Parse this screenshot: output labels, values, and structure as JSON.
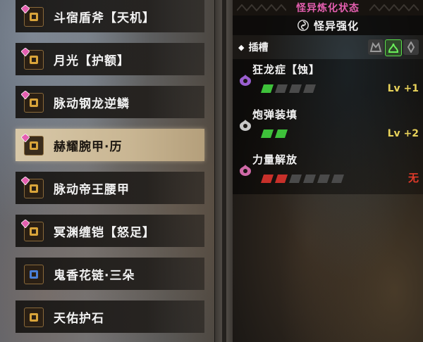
{
  "equipment_list": {
    "items": [
      {
        "name": "斗宿盾斧【天机】",
        "selected": false,
        "has_gem": true
      },
      {
        "name": "月光【护额】",
        "selected": false,
        "has_gem": true
      },
      {
        "name": "脉动钢龙逆鳞",
        "selected": false,
        "has_gem": true
      },
      {
        "name": "赫耀腕甲·历",
        "selected": true,
        "has_gem": true
      },
      {
        "name": "脉动帝王腰甲",
        "selected": false,
        "has_gem": true
      },
      {
        "name": "冥渊缠铠【怒足】",
        "selected": false,
        "has_gem": true
      },
      {
        "name": "鬼香花链·三朵",
        "selected": false,
        "has_gem": false
      },
      {
        "name": "天佑护石",
        "selected": false,
        "has_gem": false
      }
    ]
  },
  "panel": {
    "title": "怪异炼化状态",
    "subtitle": "怪异强化",
    "slots_label": "插槽",
    "skills": [
      {
        "name": "狂龙症【蚀】",
        "filled": 1,
        "total": 4,
        "fill_color": "#3ec13a",
        "level_label": "Lv",
        "level_value": "+1",
        "icon_color": "#9a5fd0"
      },
      {
        "name": "炮弹装填",
        "filled": 2,
        "total": 2,
        "fill_color": "#3ec13a",
        "level_label": "Lv",
        "level_value": "+2",
        "icon_color": "#c8c8c8"
      },
      {
        "name": "力量解放",
        "filled": 2,
        "total": 6,
        "fill_color": "#c8302a",
        "none_label": "无",
        "icon_color": "#d06aa8"
      }
    ]
  },
  "colors": {
    "title_pink": "#e55fb0",
    "level_yellow": "#e8d25a",
    "none_red": "#e23a2a",
    "bar_empty": "#4a4a4a"
  }
}
